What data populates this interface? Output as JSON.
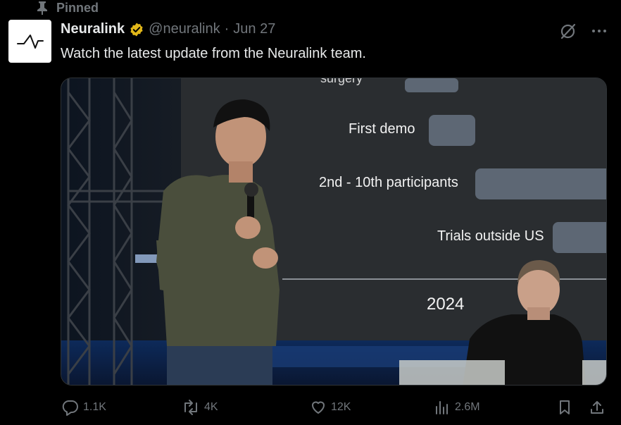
{
  "pinned": {
    "label": "Pinned"
  },
  "tweet": {
    "author_name": "Neuralink",
    "handle": "@neuralink",
    "separator": "·",
    "date": "Jun 27",
    "text": "Watch the latest update from the Neuralink team."
  },
  "media": {
    "slide_labels": {
      "partial": "surgery",
      "first_demo": "First demo",
      "participants": "2nd - 10th participants",
      "trials": "Trials outside US",
      "year": "2024"
    }
  },
  "stats": {
    "replies": "1.1K",
    "reposts": "4K",
    "likes": "12K",
    "views": "2.6M"
  },
  "icons": {
    "pin": "pin-icon",
    "verified": "verified-badge-icon",
    "grok": "grok-icon",
    "more": "more-icon",
    "reply": "reply-icon",
    "repost": "repost-icon",
    "like": "heart-icon",
    "views": "views-icon",
    "bookmark": "bookmark-icon",
    "share": "share-icon"
  },
  "colors": {
    "background": "#000000",
    "text_primary": "#e7e9ea",
    "text_secondary": "#71767b",
    "verified": "#e2b719",
    "slide_bar": "#5d6774"
  }
}
